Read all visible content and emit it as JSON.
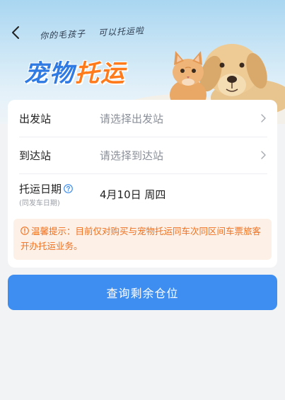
{
  "banner": {
    "slogan_part1": "你的毛孩子",
    "slogan_part2": "可以托运啦",
    "headline_blue": "宠物",
    "headline_orange": "托运",
    "image_icon": "cat-and-dog-image"
  },
  "form": {
    "departure": {
      "label": "出发站",
      "placeholder": "请选择出发站"
    },
    "arrival": {
      "label": "到达站",
      "placeholder": "请选择到达站"
    },
    "date": {
      "label": "托运日期",
      "sublabel": "(同发车日期)",
      "value": "4月10日 周四"
    }
  },
  "notice": {
    "text": "温馨提示：目前仅对购买与宠物托运同车次同区间车票旅客开办托运业务。"
  },
  "actions": {
    "query_label": "查询剩余仓位"
  },
  "colors": {
    "accent_blue": "#3d8ef0",
    "headline_orange": "#ff7a1a",
    "notice_text": "#f0701e",
    "notice_bg": "#fdf0e6"
  }
}
